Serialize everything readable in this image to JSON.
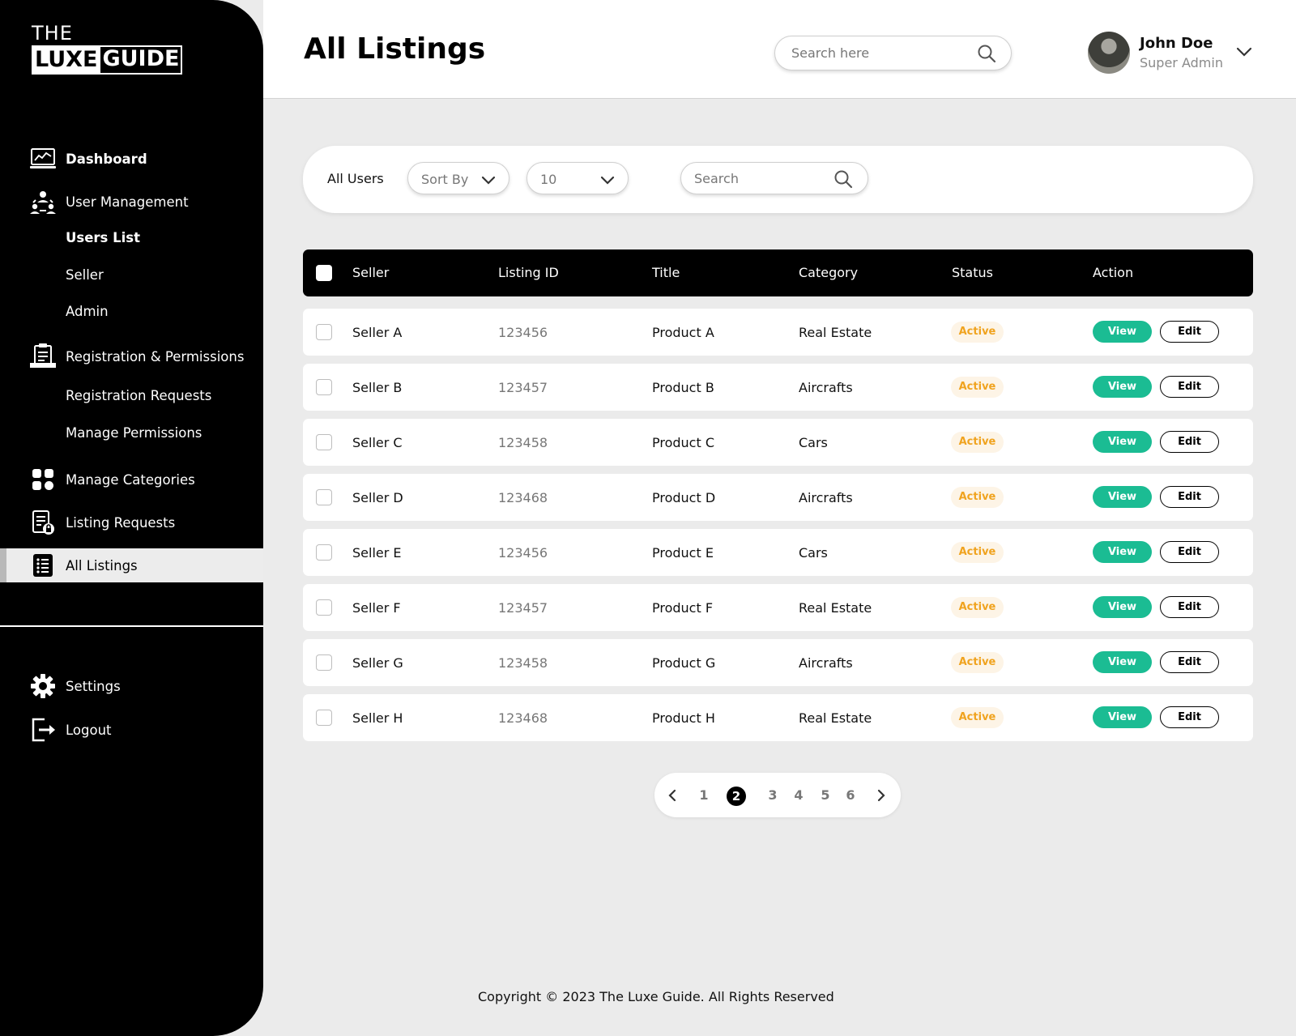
{
  "brand": {
    "line1": "THE",
    "luxe": "LUXE",
    "guide": "GUIDE"
  },
  "sidebar": {
    "items": [
      {
        "label": "Dashboard",
        "icon": "dashboard-monitor-icon"
      },
      {
        "label": "User Management",
        "icon": "user-management-icon"
      },
      {
        "label": "Registration & Permissions",
        "icon": "registration-document-icon"
      },
      {
        "label": "Manage Categories",
        "icon": "categories-grid-icon"
      },
      {
        "label": "Listing Requests",
        "icon": "listing-requests-lock-icon"
      },
      {
        "label": "All Listings",
        "icon": "list-icon"
      }
    ],
    "user_sub": [
      "Users List",
      "Seller",
      "Admin"
    ],
    "registration_sub": [
      "Registration Requests",
      "Manage Permissions"
    ],
    "bottom": [
      {
        "label": "Settings",
        "icon": "gear-icon"
      },
      {
        "label": "Logout",
        "icon": "logout-icon"
      }
    ]
  },
  "header": {
    "title": "All Listings",
    "search_placeholder": "Search here",
    "user": {
      "name": "John Doe",
      "role": "Super Admin"
    }
  },
  "filters": {
    "label": "All Users",
    "sort_by": "Sort By",
    "page_size": "10",
    "search_placeholder": "Search"
  },
  "table": {
    "columns": [
      "Seller",
      "Listing ID",
      "Title",
      "Category",
      "Status",
      "Action"
    ],
    "rows": [
      {
        "seller": "Seller A",
        "listing_id": "123456",
        "title": "Product A",
        "category": "Real Estate",
        "status": "Active"
      },
      {
        "seller": "Seller B",
        "listing_id": "123457",
        "title": "Product B",
        "category": "Aircrafts",
        "status": "Active"
      },
      {
        "seller": "Seller C",
        "listing_id": "123458",
        "title": "Product C",
        "category": "Cars",
        "status": "Active"
      },
      {
        "seller": "Seller D",
        "listing_id": "123468",
        "title": "Product D",
        "category": "Aircrafts",
        "status": "Active"
      },
      {
        "seller": "Seller E",
        "listing_id": "123456",
        "title": "Product E",
        "category": "Cars",
        "status": "Active"
      },
      {
        "seller": "Seller F",
        "listing_id": "123457",
        "title": "Product F",
        "category": "Real Estate",
        "status": "Active"
      },
      {
        "seller": "Seller G",
        "listing_id": "123458",
        "title": "Product G",
        "category": "Aircrafts",
        "status": "Active"
      },
      {
        "seller": "Seller H",
        "listing_id": "123468",
        "title": "Product H",
        "category": "Real Estate",
        "status": "Active"
      }
    ],
    "actions": {
      "view": "View",
      "edit": "Edit"
    }
  },
  "pagination": {
    "pages": [
      "1",
      "2",
      "3",
      "4",
      "5",
      "6"
    ],
    "current": "2"
  },
  "footer": {
    "copyright": "Copyright © 2023 The Luxe Guide. All Rights Reserved"
  },
  "colors": {
    "accent": "#1bbc93",
    "status_active": "#f0a31f",
    "status_bg": "#fdf4e6",
    "sidebar_bg": "#000000",
    "page_bg": "#ebebeb"
  }
}
